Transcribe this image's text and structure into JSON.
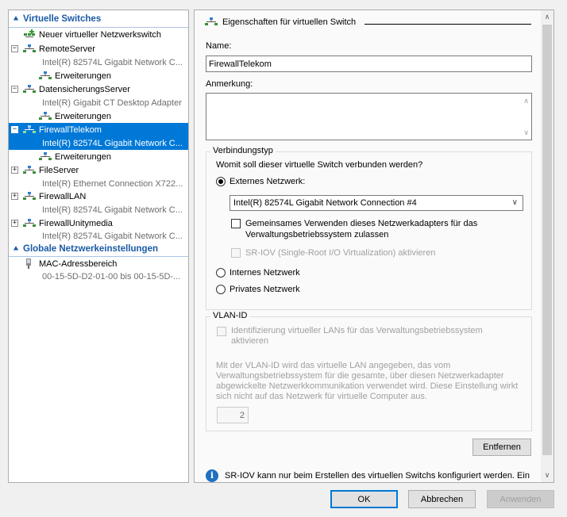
{
  "tree": {
    "section_switches": "Virtuelle Switches",
    "new_switch": "Neuer virtueller Netzwerkswitch",
    "switches": [
      {
        "name": "RemoteServer",
        "adapter": "Intel(R) 82574L Gigabit Network C...",
        "extensions": "Erweiterungen",
        "expanded": true
      },
      {
        "name": "DatensicherungsServer",
        "adapter": "Intel(R) Gigabit CT Desktop Adapter",
        "extensions": "Erweiterungen",
        "expanded": true
      },
      {
        "name": "FirewallTelekom",
        "adapter": "Intel(R) 82574L Gigabit Network C...",
        "extensions": "Erweiterungen",
        "expanded": true,
        "selected": true
      },
      {
        "name": "FileServer",
        "adapter": "Intel(R) Ethernet Connection X722...",
        "expanded": false
      },
      {
        "name": "FirewallLAN",
        "adapter": "Intel(R) 82574L Gigabit Network C...",
        "expanded": false
      },
      {
        "name": "FirewallUnitymedia",
        "adapter": "Intel(R) 82574L Gigabit Network C...",
        "expanded": false
      }
    ],
    "section_global": "Globale Netzwerkeinstellungen",
    "mac": {
      "name": "MAC-Adressbereich",
      "range": "00-15-5D-D2-01-00 bis 00-15-5D-..."
    }
  },
  "panel": {
    "header": "Eigenschaften für virtuellen Switch",
    "name_label": "Name:",
    "name_value": "FirewallTelekom",
    "notes_label": "Anmerkung:",
    "notes_value": "",
    "conn_group": "Verbindungstyp",
    "conn_question": "Womit soll dieser virtuelle Switch verbunden werden?",
    "external": "Externes Netzwerk:",
    "adapter_selected": "Intel(R) 82574L Gigabit Network Connection #4",
    "share_line1": "Gemeinsames Verwenden dieses Netzwerkadapters für das",
    "share_line2": "Verwaltungsbetriebssystem zulassen",
    "sriov": "SR-IOV (Single-Root I/O Virtualization) aktivieren",
    "internal": "Internes Netzwerk",
    "private": "Privates Netzwerk",
    "vlan_group": "VLAN-ID",
    "vlan_check1": "Identifizierung virtueller LANs für das Verwaltungsbetriebssystem",
    "vlan_check2": "aktivieren",
    "vlan_desc": [
      "Mit der VLAN-ID wird das virtuelle LAN angegeben, das vom",
      "Verwaltungsbetriebssystem für die gesamte, über diesen Netzwerkadapter",
      "abgewickelte Netzwerkkommunikation verwendet wird. Diese Einstellung wirkt",
      "sich nicht auf das Netzwerk für virtuelle Computer aus."
    ],
    "vlan_value": "2",
    "remove": "Entfernen",
    "info_line1": "SR-IOV kann nur beim Erstellen des virtuellen Switchs konfiguriert werden. Ein",
    "info_icon": "info-icon"
  },
  "buttons": {
    "ok": "OK",
    "cancel": "Abbrechen",
    "apply": "Anwenden"
  },
  "colors": {
    "accent": "#0078d7",
    "section": "#1a5aa6"
  }
}
